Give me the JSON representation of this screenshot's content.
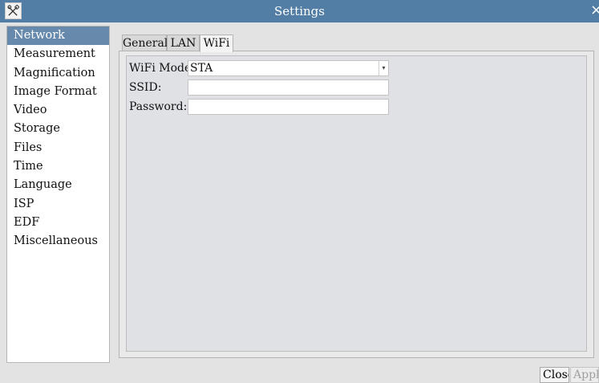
{
  "window": {
    "title": "Settings",
    "app_icon": "tools-icon",
    "close_glyph": "×"
  },
  "sidebar": {
    "items": [
      {
        "label": "Network",
        "selected": true
      },
      {
        "label": "Measurement"
      },
      {
        "label": "Magnification"
      },
      {
        "label": "Image Format"
      },
      {
        "label": "Video"
      },
      {
        "label": "Storage"
      },
      {
        "label": "Files"
      },
      {
        "label": "Time"
      },
      {
        "label": "Language"
      },
      {
        "label": "ISP"
      },
      {
        "label": "EDF"
      },
      {
        "label": "Miscellaneous"
      }
    ]
  },
  "tabs": [
    {
      "label": "General"
    },
    {
      "label": "LAN"
    },
    {
      "label": "WiFi",
      "active": true
    }
  ],
  "wifi": {
    "mode_label": "WiFi Mode:",
    "mode_value": "STA",
    "ssid_label": "SSID:",
    "ssid_value": "",
    "password_label": "Password:",
    "password_value": ""
  },
  "footer": {
    "close_label": "Close",
    "apply_label": "Apply",
    "apply_disabled": true
  },
  "colors": {
    "titlebar": "#527ea5",
    "selected_item": "#6789ab"
  }
}
